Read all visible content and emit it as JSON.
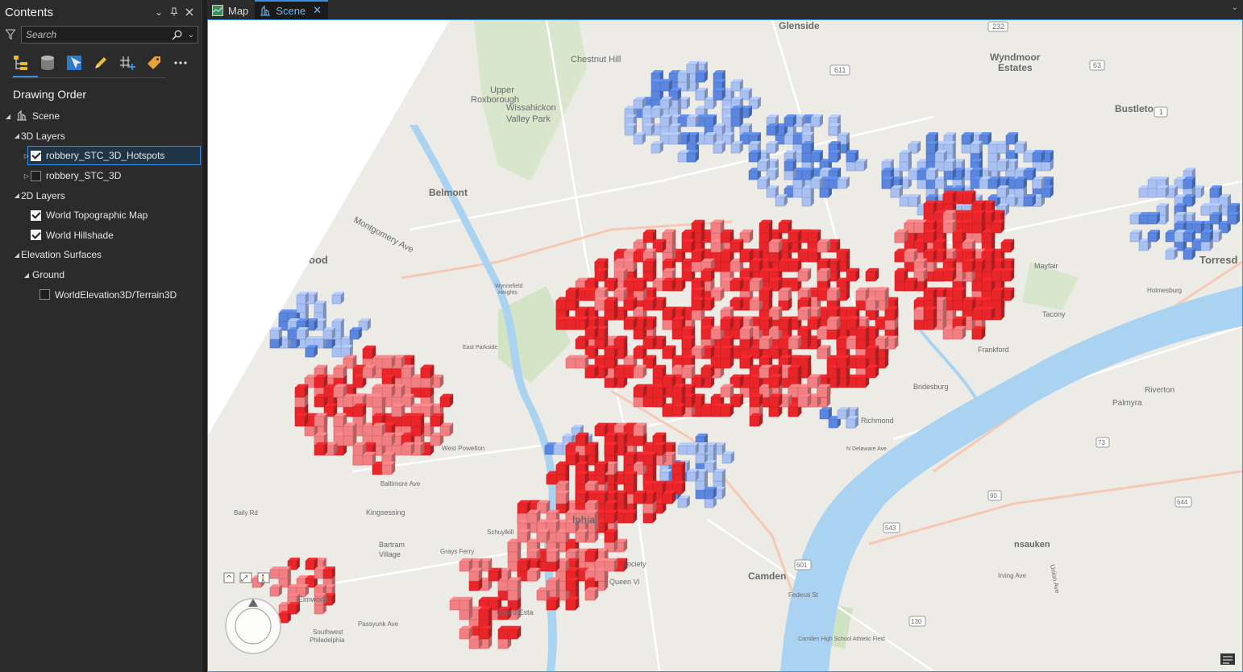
{
  "contents": {
    "title": "Contents",
    "search_placeholder": "Search",
    "heading": "Drawing Order",
    "tree": {
      "scene": "Scene",
      "group_3d": "3D Layers",
      "hotspots": "robbery_STC_3D_Hotspots",
      "stc3d": "robbery_STC_3D",
      "group_2d": "2D Layers",
      "topo": "World Topographic Map",
      "hillshade": "World Hillshade",
      "elev": "Elevation Surfaces",
      "ground": "Ground",
      "terrain": "WorldElevation3D/Terrain3D"
    }
  },
  "tabs": {
    "map": "Map",
    "scene": "Scene"
  },
  "colors": {
    "hot": "#e8262a",
    "hot_light": "#f27f82",
    "cold": "#5a86df",
    "cold_light": "#a9c0f2",
    "water": "#aad3f2",
    "accent": "#3b8edb"
  },
  "map_labels": {
    "glenside": "Glenside",
    "wyndmoor": "Wyndmoor",
    "estates": "Estates",
    "chestnut_hill": "Chestnut Hill",
    "upper": "Upper",
    "roxborough": "Roxborough",
    "wissahickon": "Wissahickon",
    "valley_park": "Valley Park",
    "belmont": "Belmont",
    "montgomery_ave": "Montgomery Ave",
    "wood": "ood",
    "bustleton": "Bustleto",
    "mayfair": "Mayfair",
    "holmesburg": "Holmesburg",
    "torresdale": "Torresd",
    "tacony": "Tacony",
    "frankford": "Frankford",
    "bridesburg": "Bridesburg",
    "richmond": "Richmond",
    "riverton": "Riverton",
    "palmyra": "Palmyra",
    "delaware": "Delaware",
    "philadelphia": "lphia",
    "camden": "Camden",
    "pennsauken": "nsauken",
    "west_philadelphia": "West Powelton",
    "kingsessing": "Kingsessing",
    "bartram": "Bartram",
    "village": "Village",
    "elmwood": "Elmwood",
    "passyunk": "Passyunk Ave",
    "southwest": "Southwest",
    "philly2": "Philadelphia",
    "baltimore": "Baltimore Ave",
    "baily_rd": "Baily Rd",
    "queen_vi": "Queen Vi",
    "society": "Society",
    "girard": "Girard Esta",
    "schuylkill": "Schuylkill",
    "grays_ferry": "Grays Ferry",
    "east_parkside": "East Parkside",
    "wynnefield": "Wynnefield",
    "heights": "Heights",
    "camden_high": "Camden High School Athletic Field",
    "irving_ave": "Irving Ave",
    "union_ave": "Union Ave",
    "federal_st": "Federal St",
    "n_delaware": "N Delaware Ave",
    "rt_611": "611",
    "rt_232": "232",
    "rt_63": "63",
    "rt_1": "1",
    "rt_73": "73",
    "rt_90": "90",
    "rt_130": "130",
    "rt_543": "543",
    "rt_601": "601",
    "rt_644": "644"
  },
  "nav_controls": {
    "up": "^",
    "pan": "⤢",
    "walk": "🚶"
  }
}
